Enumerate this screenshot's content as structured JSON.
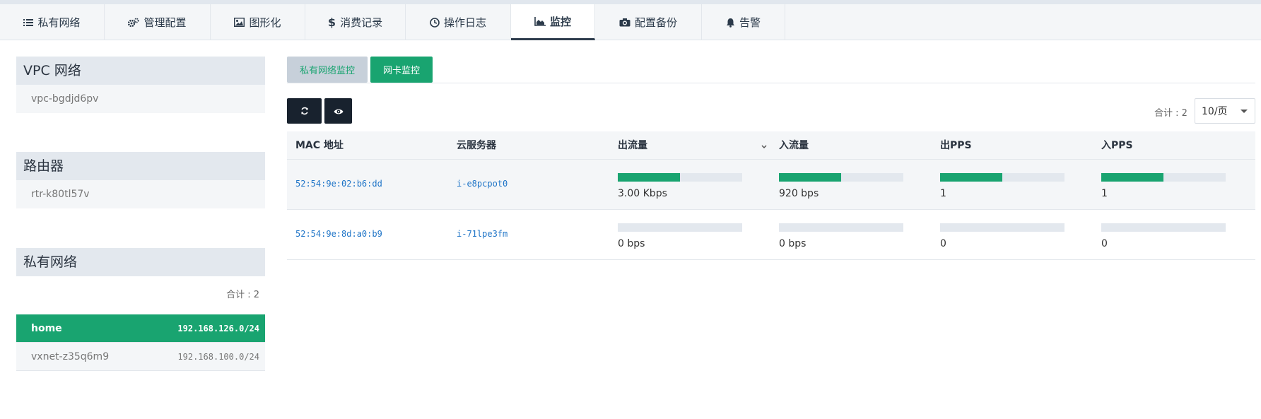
{
  "tabs": [
    {
      "label": "私有网络",
      "icon": "list-icon"
    },
    {
      "label": "管理配置",
      "icon": "gears-icon"
    },
    {
      "label": "图形化",
      "icon": "image-icon"
    },
    {
      "label": "消费记录",
      "icon": "dollar-icon"
    },
    {
      "label": "操作日志",
      "icon": "clock-icon"
    },
    {
      "label": "监控",
      "icon": "area-chart-icon",
      "active": true
    },
    {
      "label": "配置备份",
      "icon": "camera-icon"
    },
    {
      "label": "告警",
      "icon": "bell-icon"
    }
  ],
  "sidebar": {
    "vpc": {
      "title": "VPC 网络",
      "value": "vpc-bgdjd6pv"
    },
    "router": {
      "title": "路由器",
      "value": "rtr-k80tl57v"
    },
    "vxnets": {
      "title": "私有网络",
      "count": "合计 : 2",
      "items": [
        {
          "name": "home",
          "cidr": "192.168.126.0/24",
          "active": true
        },
        {
          "name": "vxnet-z35q6m9",
          "cidr": "192.168.100.0/24",
          "active": false
        }
      ]
    }
  },
  "subtabs": {
    "vxnet_monitor": "私有网络监控",
    "nic_monitor": "网卡监控"
  },
  "toolbar": {
    "refresh_icon": "refresh-icon",
    "view_icon": "eye-icon",
    "total": "合计 : 2",
    "page_size": "10/页"
  },
  "table": {
    "headers": {
      "mac": "MAC 地址",
      "server": "云服务器",
      "tx": "出流量",
      "rx": "入流量",
      "tx_pps": "出PPS",
      "rx_pps": "入PPS"
    },
    "rows": [
      {
        "mac": "52:54:9e:02:b6:dd",
        "server": "i-e8pcpot0",
        "tx": "3.00 Kbps",
        "rx": "920 bps",
        "tx_pps": "1",
        "rx_pps": "1",
        "tx_level": 0.5,
        "rx_level": 0.5,
        "tx_pps_level": 0.5,
        "rx_pps_level": 0.5
      },
      {
        "mac": "52:54:9e:8d:a0:b9",
        "server": "i-71lpe3fm",
        "tx": "0 bps",
        "rx": "0 bps",
        "tx_pps": "0",
        "rx_pps": "0",
        "tx_level": 0,
        "rx_level": 0,
        "tx_pps_level": 0,
        "rx_pps_level": 0
      }
    ]
  },
  "colors": {
    "accent": "#19a470",
    "dark": "#18222e",
    "link": "#1e74c7"
  }
}
